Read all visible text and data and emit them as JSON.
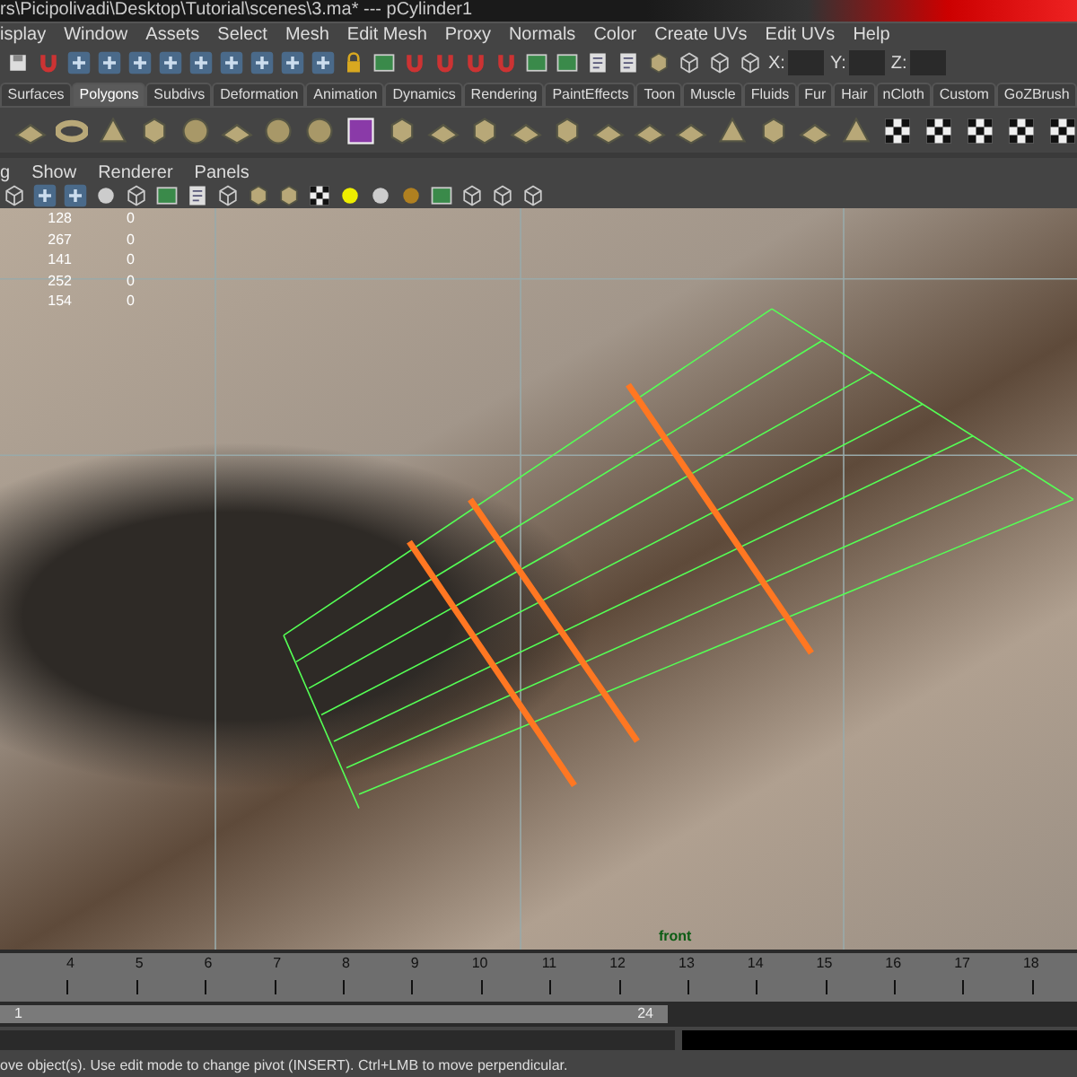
{
  "window": {
    "title": "rs\\Picipolivadi\\Desktop\\Tutorial\\scenes\\3.ma*   ---   pCylinder1"
  },
  "menu": [
    "isplay",
    "Window",
    "Assets",
    "Select",
    "Mesh",
    "Edit Mesh",
    "Proxy",
    "Normals",
    "Color",
    "Create UVs",
    "Edit UVs",
    "Help"
  ],
  "coordinate_fields": [
    {
      "label": "X:"
    },
    {
      "label": "Y:"
    },
    {
      "label": "Z:"
    }
  ],
  "shelf_tabs": [
    {
      "label": "Surfaces",
      "selected": false
    },
    {
      "label": "Polygons",
      "selected": true
    },
    {
      "label": "Subdivs",
      "selected": false
    },
    {
      "label": "Deformation",
      "selected": false
    },
    {
      "label": "Animation",
      "selected": false
    },
    {
      "label": "Dynamics",
      "selected": false
    },
    {
      "label": "Rendering",
      "selected": false
    },
    {
      "label": "PaintEffects",
      "selected": false
    },
    {
      "label": "Toon",
      "selected": false
    },
    {
      "label": "Muscle",
      "selected": false
    },
    {
      "label": "Fluids",
      "selected": false
    },
    {
      "label": "Fur",
      "selected": false
    },
    {
      "label": "Hair",
      "selected": false
    },
    {
      "label": "nCloth",
      "selected": false
    },
    {
      "label": "Custom",
      "selected": false
    },
    {
      "label": "GoZBrush",
      "selected": false
    }
  ],
  "panel_menu": [
    "g",
    "Show",
    "Renderer",
    "Panels"
  ],
  "viewport": {
    "hud": [
      {
        "value": "128",
        "count": "0"
      },
      {
        "value": "267",
        "count": "0"
      },
      {
        "value": "141",
        "count": "0"
      },
      {
        "value": "252",
        "count": "0"
      },
      {
        "value": "154",
        "count": "0"
      }
    ],
    "camera_label": "front"
  },
  "time_slider": {
    "ticks": [
      "4",
      "5",
      "6",
      "7",
      "8",
      "9",
      "10",
      "11",
      "12",
      "13",
      "14",
      "15",
      "16",
      "17",
      "18"
    ]
  },
  "range_slider": {
    "start": "1",
    "end": "24",
    "level": 0.62
  },
  "help_line": "ove object(s). Use edit mode to change pivot (INSERT).  Ctrl+LMB to move perpendicular."
}
